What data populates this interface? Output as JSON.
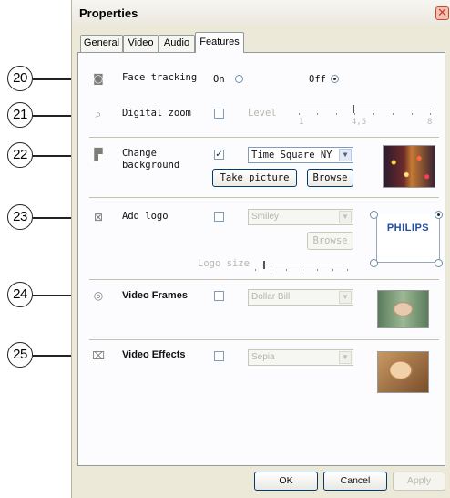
{
  "window": {
    "title": "Properties"
  },
  "tabs": [
    "General",
    "Video",
    "Audio",
    "Features"
  ],
  "active_tab": "Features",
  "callouts": [
    "20",
    "21",
    "22",
    "23",
    "24",
    "25"
  ],
  "face_tracking": {
    "label": "Face tracking",
    "on_label": "On",
    "off_label": "Off",
    "selected": "Off"
  },
  "digital_zoom": {
    "label": "Digital zoom",
    "checked": false,
    "level_label": "Level",
    "tick_min": "1",
    "tick_mid": "4,5",
    "tick_max": "8"
  },
  "change_background": {
    "label_line1": "Change",
    "label_line2": "background",
    "checked": true,
    "check_glyph": "✓",
    "selected": "Time Square NY",
    "take_picture": "Take picture",
    "browse": "Browse"
  },
  "add_logo": {
    "label": "Add logo",
    "checked": false,
    "selected": "Smiley",
    "browse": "Browse",
    "logo_size_label": "Logo size",
    "preview_text": "PHILIPS"
  },
  "video_frames": {
    "label": "Video Frames",
    "checked": false,
    "selected": "Dollar Bill"
  },
  "video_effects": {
    "label": "Video Effects",
    "checked": false,
    "selected": "Sepia"
  },
  "buttons": {
    "ok": "OK",
    "cancel": "Cancel",
    "apply": "Apply"
  },
  "icons": {
    "close": "close-icon",
    "face_tracking": "face-tracking-icon",
    "digital_zoom": "magnifier-icon",
    "change_background": "background-icon",
    "add_logo": "logo-icon",
    "video_frames": "frame-icon",
    "video_effects": "effects-icon",
    "dropdown": "chevron-down-icon"
  },
  "colors": {
    "window_bg": "#ece9d8",
    "panel_bg": "#fcfcfe",
    "tab_border": "#919b9c",
    "logo_blue": "#1f4ea3"
  }
}
